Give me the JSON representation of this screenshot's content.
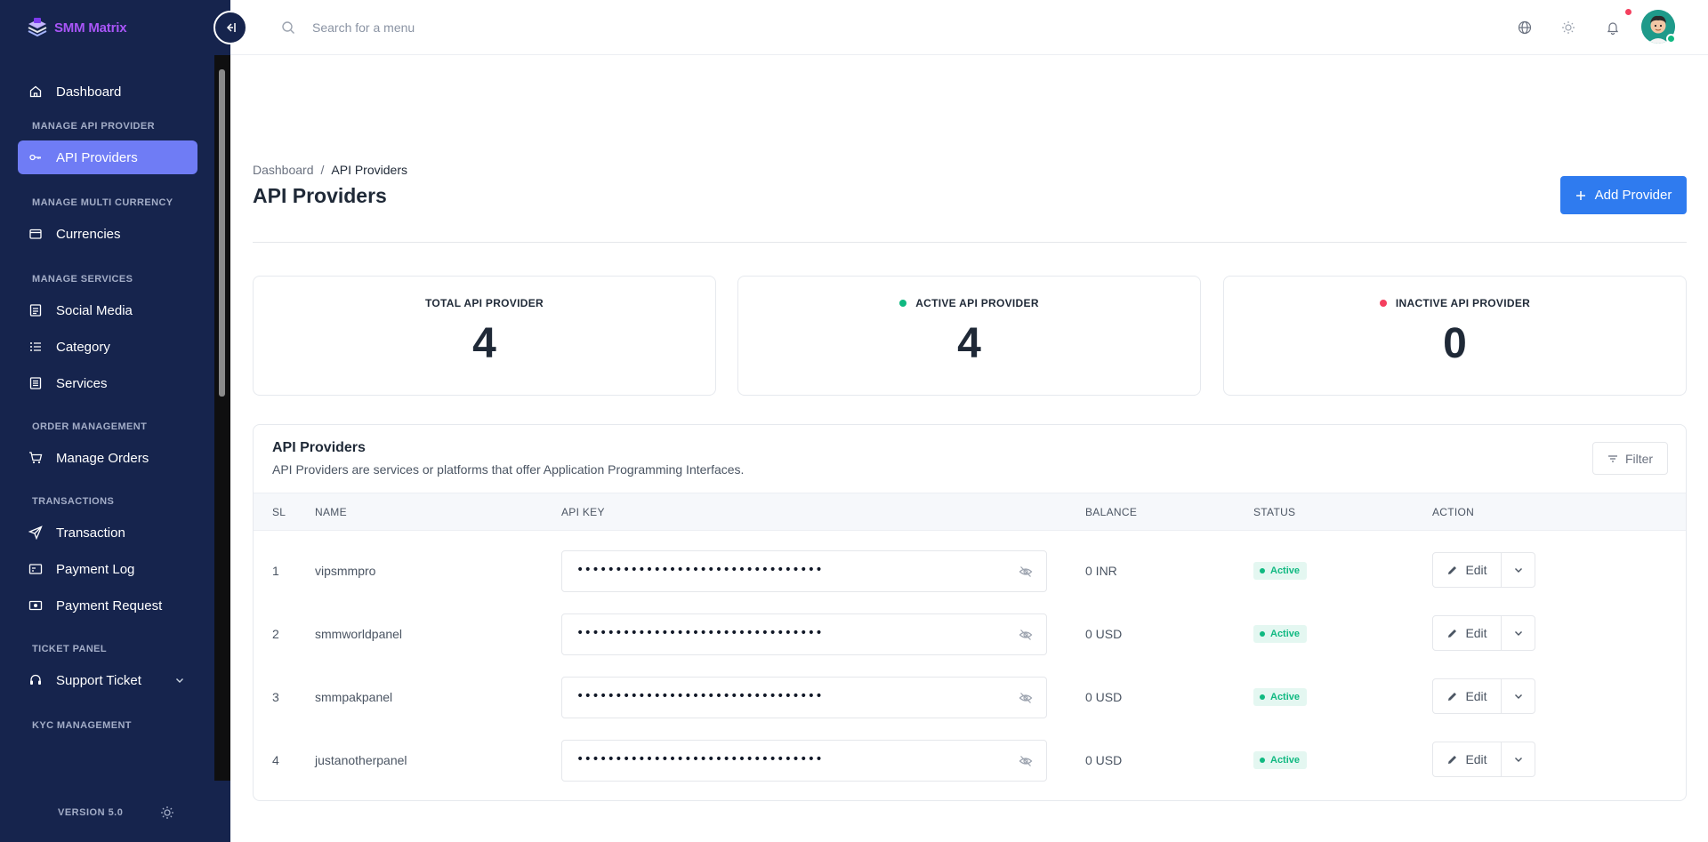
{
  "brand": {
    "name": "SMM Matrix"
  },
  "sidebar": {
    "dashboard": "Dashboard",
    "sections": {
      "api": "MANAGE API PROVIDER",
      "currency": "MANAGE MULTI CURRENCY",
      "services": "MANAGE SERVICES",
      "orders": "ORDER MANAGEMENT",
      "transactions": "TRANSACTIONS",
      "ticket": "TICKET PANEL",
      "kyc": "KYC MANAGEMENT"
    },
    "items": {
      "api_providers": "API Providers",
      "currencies": "Currencies",
      "social_media": "Social Media",
      "category": "Category",
      "services": "Services",
      "manage_orders": "Manage Orders",
      "transaction": "Transaction",
      "payment_log": "Payment Log",
      "payment_request": "Payment Request",
      "support_ticket": "Support Ticket"
    },
    "version": "VERSION 5.0"
  },
  "header": {
    "search_placeholder": "Search for a menu"
  },
  "breadcrumb": {
    "root": "Dashboard",
    "sep": "/",
    "current": "API Providers"
  },
  "page": {
    "title": "API Providers",
    "add_button": "Add Provider"
  },
  "stats": [
    {
      "label": "TOTAL API PROVIDER",
      "value": "4"
    },
    {
      "label": "ACTIVE API PROVIDER",
      "value": "4",
      "dot": "#10b981"
    },
    {
      "label": "INACTIVE API PROVIDER",
      "value": "0",
      "dot": "#f43f5e"
    }
  ],
  "table": {
    "title": "API Providers",
    "subtitle": "API Providers are services or platforms that offer Application Programming Interfaces.",
    "filter_label": "Filter",
    "columns": {
      "sl": "SL",
      "name": "NAME",
      "api_key": "API KEY",
      "balance": "BALANCE",
      "status": "STATUS",
      "action": "ACTION"
    },
    "rows": [
      {
        "sl": "1",
        "name": "vipsmmpro",
        "api_key": "••••••••••••••••••••••••••••••••",
        "balance": "0 INR",
        "status": "Active",
        "action": "Edit"
      },
      {
        "sl": "2",
        "name": "smmworldpanel",
        "api_key": "••••••••••••••••••••••••••••••••",
        "balance": "0 USD",
        "status": "Active",
        "action": "Edit"
      },
      {
        "sl": "3",
        "name": "smmpakpanel",
        "api_key": "••••••••••••••••••••••••••••••••",
        "balance": "0 USD",
        "status": "Active",
        "action": "Edit"
      },
      {
        "sl": "4",
        "name": "justanotherpanel",
        "api_key": "••••••••••••••••••••••••••••••••",
        "balance": "0 USD",
        "status": "Active",
        "action": "Edit"
      }
    ]
  },
  "colors": {
    "sidebar_bg": "#16244d",
    "active_item": "#6f7cf5",
    "primary": "#2f7bef",
    "success": "#10b981",
    "danger": "#f43f5e"
  }
}
